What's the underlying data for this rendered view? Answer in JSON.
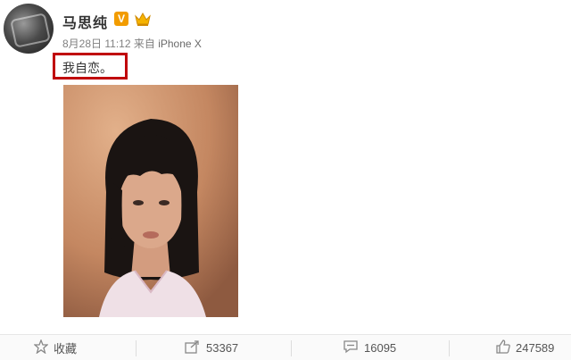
{
  "post": {
    "username": "马思纯",
    "verified_badge": "V",
    "timestamp": "8月28日 11:12",
    "source_prefix": "来自",
    "device": "iPhone X",
    "text": "我自恋。"
  },
  "actions": {
    "favorite_label": "收藏",
    "repost_count": "53367",
    "comment_count": "16095",
    "like_count": "247589"
  },
  "colors": {
    "highlight_box": "#c0000a",
    "verified_badge": "#f29c00",
    "meta_text": "#808080"
  },
  "icons": {
    "favorite": "star-icon",
    "repost": "share-icon",
    "comment": "comment-icon",
    "like": "thumbs-up-icon"
  }
}
